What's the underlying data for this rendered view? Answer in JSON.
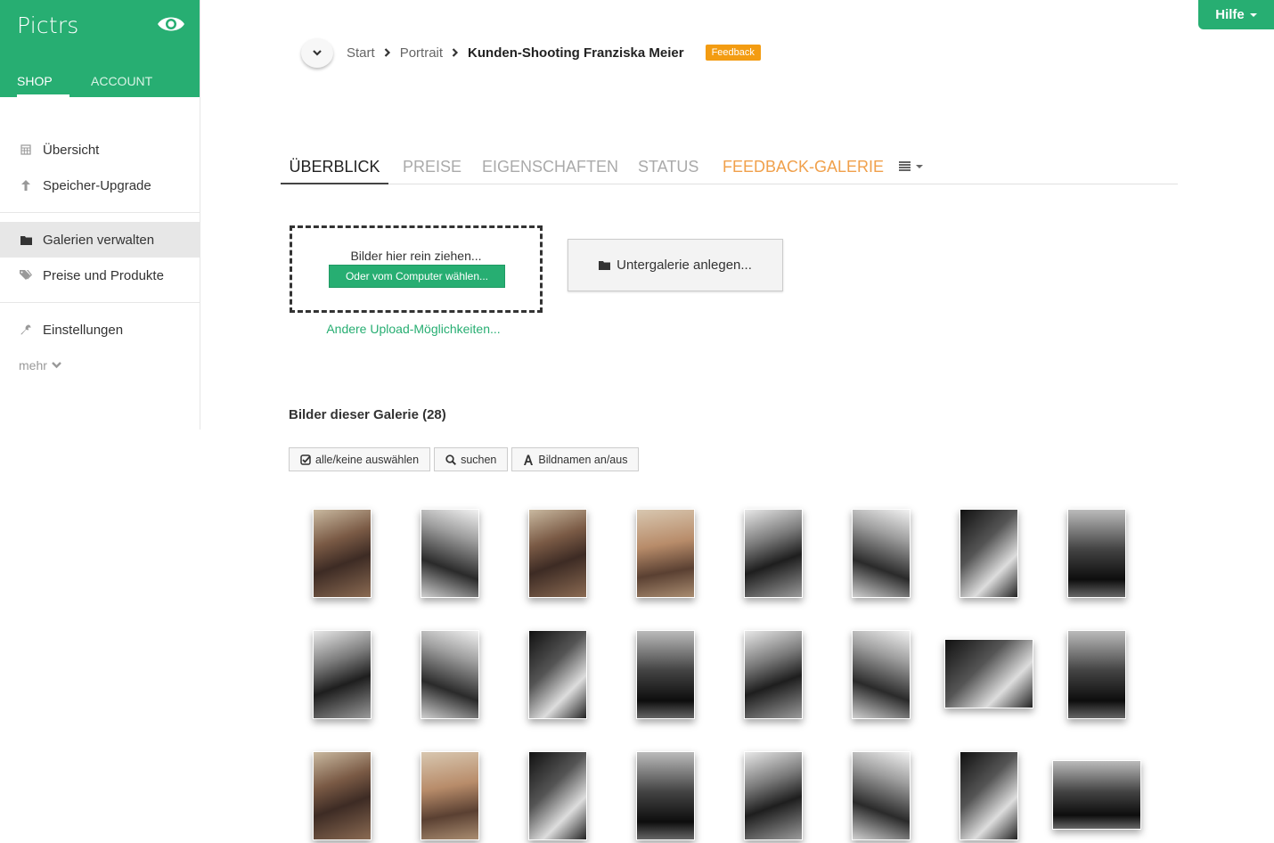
{
  "brand": {
    "title": "Pictrs",
    "color": "#27ae72"
  },
  "brand_tabs": [
    {
      "label": "SHOP",
      "active": true
    },
    {
      "label": "ACCOUNT",
      "active": false
    }
  ],
  "nav": {
    "items": [
      {
        "label": "Übersicht",
        "icon": "calendar-icon"
      },
      {
        "label": "Speicher-Upgrade",
        "icon": "arrow-up-icon"
      },
      {
        "label": "Galerien verwalten",
        "icon": "folder-icon",
        "active": true
      },
      {
        "label": "Preise und Produkte",
        "icon": "tags-icon"
      },
      {
        "label": "Einstellungen",
        "icon": "wrench-icon"
      }
    ],
    "more_label": "mehr"
  },
  "help": {
    "label": "Hilfe"
  },
  "breadcrumb": {
    "items": [
      "Start",
      "Portrait"
    ],
    "current": "Kunden-Shooting Franziska Meier",
    "badge": "Feedback",
    "badge_color": "#f39c12"
  },
  "tabs": [
    {
      "label": "ÜBERBLICK",
      "active": true
    },
    {
      "label": "PREISE"
    },
    {
      "label": "EIGENSCHAFTEN"
    },
    {
      "label": "STATUS"
    },
    {
      "label": "FEEDBACK-GALERIE",
      "accent": "#f0a04b"
    }
  ],
  "upload": {
    "drop_text": "Bilder hier rein ziehen...",
    "button_label": "Oder vom Computer wählen...",
    "other_link": "Andere Upload-Möglichkeiten...",
    "subgallery_label": "Untergalerie anlegen..."
  },
  "gallery": {
    "title": "Bilder dieser Galerie (28)",
    "tools": [
      {
        "label": "alle/keine auswählen",
        "icon": "check-square-icon"
      },
      {
        "label": "suchen",
        "icon": "search-icon"
      },
      {
        "label": "Bildnamen an/aus",
        "icon": "font-icon"
      }
    ],
    "thumbnails": [
      {
        "tone": "color",
        "orientation": "portrait"
      },
      {
        "tone": "bw",
        "orientation": "portrait"
      },
      {
        "tone": "color",
        "orientation": "portrait"
      },
      {
        "tone": "color",
        "orientation": "portrait"
      },
      {
        "tone": "bw",
        "orientation": "portrait"
      },
      {
        "tone": "bw",
        "orientation": "portrait"
      },
      {
        "tone": "bw",
        "orientation": "portrait"
      },
      {
        "tone": "bw",
        "orientation": "portrait"
      },
      {
        "tone": "bw",
        "orientation": "portrait"
      },
      {
        "tone": "bw",
        "orientation": "portrait"
      },
      {
        "tone": "bw",
        "orientation": "portrait"
      },
      {
        "tone": "bw",
        "orientation": "portrait"
      },
      {
        "tone": "bw",
        "orientation": "portrait"
      },
      {
        "tone": "bw",
        "orientation": "portrait"
      },
      {
        "tone": "bw",
        "orientation": "landscape"
      },
      {
        "tone": "bw",
        "orientation": "portrait"
      },
      {
        "tone": "color",
        "orientation": "portrait"
      },
      {
        "tone": "color",
        "orientation": "portrait"
      },
      {
        "tone": "bw",
        "orientation": "portrait"
      },
      {
        "tone": "bw",
        "orientation": "portrait"
      },
      {
        "tone": "bw",
        "orientation": "portrait"
      },
      {
        "tone": "bw",
        "orientation": "portrait"
      },
      {
        "tone": "bw",
        "orientation": "portrait"
      },
      {
        "tone": "bw",
        "orientation": "landscape"
      }
    ]
  }
}
